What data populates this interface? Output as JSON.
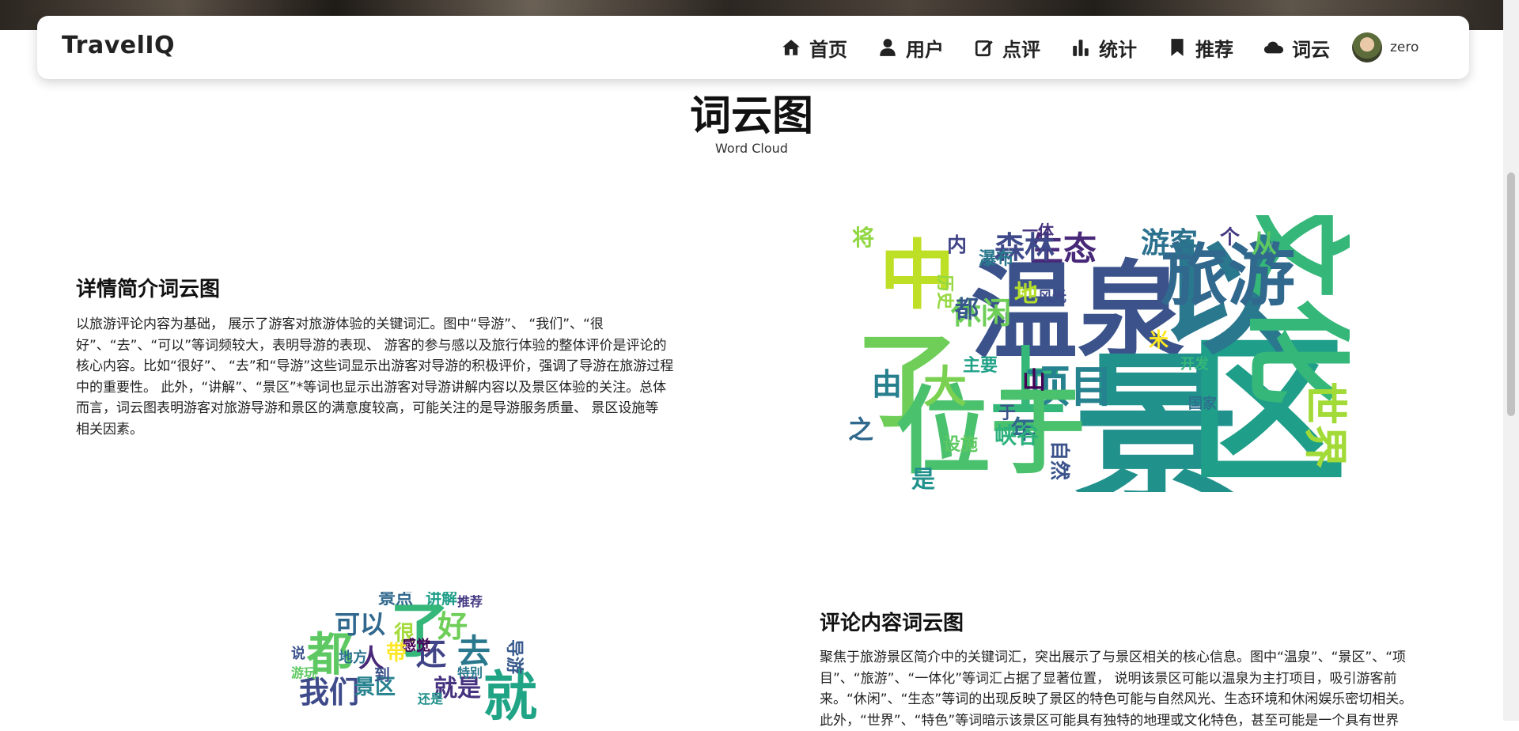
{
  "nav": {
    "brand": "TravelIQ",
    "items": [
      {
        "label": "首页",
        "icon": "home-icon"
      },
      {
        "label": "用户",
        "icon": "user-icon"
      },
      {
        "label": "点评",
        "icon": "edit-icon"
      },
      {
        "label": "统计",
        "icon": "chart-bar-icon"
      },
      {
        "label": "推荐",
        "icon": "bookmark-icon"
      },
      {
        "label": "词云",
        "icon": "cloud-icon"
      }
    ],
    "user_name": "zero"
  },
  "page": {
    "title": "词云图",
    "subtitle": "Word Cloud"
  },
  "section1": {
    "heading": "详情简介词云图",
    "lines": [
      "以旅游评论内容为基础， 展示了游客对旅游体验的关键词汇。图中“导游”、 “我们”、“很",
      "好”、“去”、“可以”等词频较大，表明导游的表现、 游客的参与感以及旅行体验的整体评价是评论的",
      "核心内容。比如“很好”、 “去”和“导游”这些词显示出游客对导游的积极评价，强调了导游在旅游过程",
      "中的重要性。 此外，“讲解”、“景区”*等词也显示出游客对导游讲解内容以及景区体验的关注。总体",
      "而言，词云图表明游客对旅游导游和景区的满意度较高，可能关注的是导游服务质量、 景区设施等",
      "相关因素。"
    ]
  },
  "section2": {
    "heading": "评论内容词云图",
    "lines": [
      "聚焦于旅游景区简介中的关键词汇，突出展示了与景区相关的核心信息。图中“温泉”、“景区”、“项",
      "目”、“旅游”、“一体化”等词汇占据了显著位置， 说明该景区可能以温泉为主打项目，吸引游客前",
      "来。“休闲”、“生态”等词的出现反映了景区的特色可能与自然风光、生态环境和休闲娱乐密切相关。",
      "此外，“世界”、“特色”等词暗示该景区可能具有独特的地理或文化特色，甚至可能是一个具有世界"
    ]
  },
  "cloud1_words": [
    {
      "t": "温泉",
      "c": "#3b528b"
    },
    {
      "t": "景",
      "c": "#21918c"
    },
    {
      "t": "区",
      "c": "#1f9e89"
    },
    {
      "t": "以",
      "c": "#2a788e"
    },
    {
      "t": "文化",
      "c": "#35b779"
    },
    {
      "t": "中",
      "c": "#bddf26"
    },
    {
      "t": "了",
      "c": "#6ece58"
    },
    {
      "t": "上",
      "c": "#35b779"
    },
    {
      "t": "旅游",
      "c": "#31688e"
    },
    {
      "t": "项目",
      "c": "#26828e"
    },
    {
      "t": "位于",
      "c": "#4ac16d"
    },
    {
      "t": "大",
      "c": "#7ad151"
    },
    {
      "t": "生态",
      "c": "#482878"
    },
    {
      "t": "森林",
      "c": "#3e4a89"
    },
    {
      "t": "休闲",
      "c": "#6ece58"
    },
    {
      "t": "游客",
      "c": "#2c728e"
    },
    {
      "t": "都",
      "c": "#38598c"
    },
    {
      "t": "山",
      "c": "#440154"
    },
    {
      "t": "年",
      "c": "#31688e"
    },
    {
      "t": "世界",
      "c": "#a2da37"
    },
    {
      "t": "峡谷",
      "c": "#2db27d"
    },
    {
      "t": "自然",
      "c": "#3b528b"
    },
    {
      "t": "之",
      "c": "#31688e"
    },
    {
      "t": "由",
      "c": "#277f8e"
    },
    {
      "t": "个",
      "c": "#443983"
    },
    {
      "t": "从",
      "c": "#5ec962"
    },
    {
      "t": "米",
      "c": "#fde725"
    },
    {
      "t": "内",
      "c": "#414487"
    },
    {
      "t": "瀑布",
      "c": "#2a788e"
    },
    {
      "t": "主要",
      "c": "#1fa187"
    },
    {
      "t": "开发",
      "c": "#35b779"
    },
    {
      "t": "历史",
      "c": "#95d840"
    },
    {
      "t": "将",
      "c": "#90d743"
    },
    {
      "t": "于",
      "c": "#3b528b"
    },
    {
      "t": "一体",
      "c": "#46327e"
    },
    {
      "t": "国家",
      "c": "#2c728e"
    },
    {
      "t": "地",
      "c": "#b5de2b"
    },
    {
      "t": "风光",
      "c": "#3e4a89"
    },
    {
      "t": "是",
      "c": "#21918c"
    },
    {
      "t": "设施",
      "c": "#5ec962"
    }
  ],
  "cloud2_words": [
    {
      "t": "了",
      "c": "#35b779"
    },
    {
      "t": "就",
      "c": "#20a486"
    },
    {
      "t": "都",
      "c": "#5ec962"
    },
    {
      "t": "我们",
      "c": "#3e4a89"
    },
    {
      "t": "可以",
      "c": "#31688e"
    },
    {
      "t": "好",
      "c": "#6ece58"
    },
    {
      "t": "去",
      "c": "#2a788e"
    },
    {
      "t": "还",
      "c": "#414487"
    },
    {
      "t": "人",
      "c": "#482878"
    },
    {
      "t": "景区",
      "c": "#26828e"
    },
    {
      "t": "就是",
      "c": "#46327e"
    },
    {
      "t": "景点",
      "c": "#31688e"
    },
    {
      "t": "讲解",
      "c": "#1f9e89"
    },
    {
      "t": "很",
      "c": "#a2da37"
    },
    {
      "t": "到",
      "c": "#3b528b"
    },
    {
      "t": "地方",
      "c": "#2c728e"
    },
    {
      "t": "导游",
      "c": "#38598c"
    },
    {
      "t": "感觉",
      "c": "#440154"
    },
    {
      "t": "游玩",
      "c": "#5ec962"
    },
    {
      "t": "推荐",
      "c": "#443983"
    },
    {
      "t": "特别",
      "c": "#2a788e"
    },
    {
      "t": "带",
      "c": "#fde725"
    },
    {
      "t": "说",
      "c": "#3b528b"
    },
    {
      "t": "还是",
      "c": "#21918c"
    }
  ]
}
